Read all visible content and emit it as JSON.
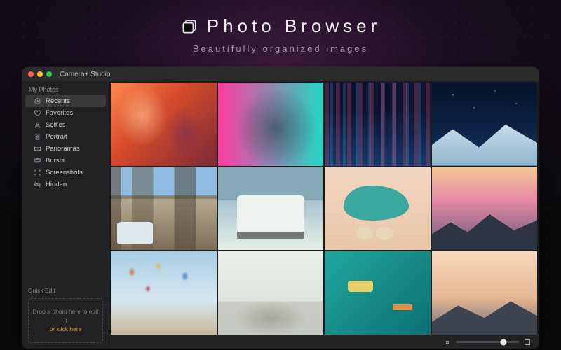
{
  "hero": {
    "title": "Photo Browser",
    "subtitle": "Beautifully organized images",
    "icon": "stack-icon"
  },
  "window": {
    "title": "Camera+ Studio",
    "traffic": {
      "close": "#ff5f57",
      "min": "#febc2e",
      "max": "#28c840"
    }
  },
  "sidebar": {
    "section_title": "My Photos",
    "items": [
      {
        "icon": "clock-icon",
        "label": "Recents",
        "selected": true
      },
      {
        "icon": "heart-icon",
        "label": "Favorites",
        "selected": false
      },
      {
        "icon": "person-icon",
        "label": "Selfies",
        "selected": false
      },
      {
        "icon": "portrait-icon",
        "label": "Portrait",
        "selected": false
      },
      {
        "icon": "panorama-icon",
        "label": "Panoramas",
        "selected": false
      },
      {
        "icon": "burst-icon",
        "label": "Bursts",
        "selected": false
      },
      {
        "icon": "screenshot-icon",
        "label": "Screenshots",
        "selected": false
      },
      {
        "icon": "hidden-icon",
        "label": "Hidden",
        "selected": false
      }
    ]
  },
  "quick_edit": {
    "title": "Quick Edit",
    "drop_text": "Drop a photo here to edit it",
    "link_text": "or click here"
  },
  "toolbar": {
    "thumb_size": 0.75
  },
  "colors": {
    "accent_link": "#d99a3d",
    "window_bg": "#1c1c1e",
    "sidebar_bg": "#222224"
  }
}
